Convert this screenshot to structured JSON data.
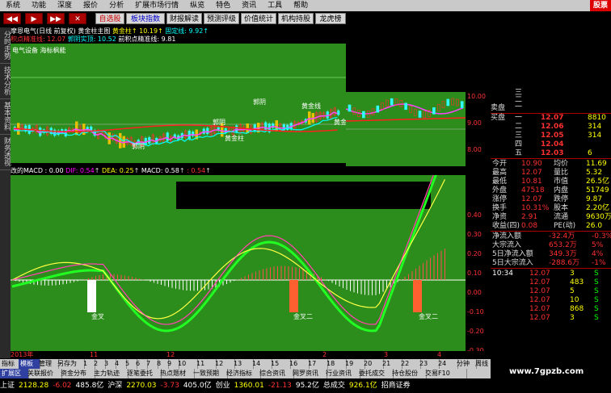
{
  "menu": {
    "items": [
      "系统",
      "功能",
      "深度",
      "报价",
      "分析",
      "扩展市场行情",
      "纵览",
      "特色",
      "资讯",
      "工具",
      "帮助"
    ],
    "brand": "股票"
  },
  "toolbar": {
    "nav_buttons": [
      "◀◀",
      "▶",
      "▶▶",
      "✕"
    ],
    "tabs": [
      {
        "label": "自选股",
        "color": "red"
      },
      {
        "label": "板块指数",
        "color": "blue"
      },
      {
        "label": "财报解读",
        "color": "normal"
      },
      {
        "label": "预测评级",
        "color": "normal"
      },
      {
        "label": "价值统计",
        "color": "normal"
      },
      {
        "label": "机构持股",
        "color": "normal"
      },
      {
        "label": "龙虎榜",
        "color": "normal"
      }
    ]
  },
  "left_vtabs": [
    "分时走势",
    "技术分析",
    "基本资料",
    "财务透视"
  ],
  "info": {
    "line1_a": "摩恩电气(日线 前复权) 黄金柱主图",
    "line1_b": "黄金柱↑",
    "line1_c": "10.19↑",
    "line1_d": "固定线: 9.92↑",
    "line2_a": "积点精准线: 12.07",
    "line2_b": "郭阴实顶: 10.52",
    "line2_c": "前积点精准线: 9.81",
    "chart_label": "电气设备 海标枫能"
  },
  "chart_labels": {
    "yin": "郭阴",
    "gold": "黄金柱",
    "gold_line": "黄金线",
    "cross": "金叉二",
    "cross1": "金叉"
  },
  "main_axis": [
    "10.00",
    "9.00",
    "8.00"
  ],
  "macd": {
    "name": "改的MACD",
    "v0": ": 0.00",
    "dif": "DIF: 0.54",
    "dea": "DEA: 0.25",
    "macd": "MACD: 0.58",
    "extra": ": 0.54",
    "axis": [
      "0.40",
      "0.30",
      "0.20",
      "0.10",
      "0.00",
      "-0.10",
      "-0.20",
      "-0.30"
    ]
  },
  "date_axis": [
    {
      "label": "2013年",
      "pos": 0
    },
    {
      "label": "11",
      "pos": 98
    },
    {
      "label": "12",
      "pos": 193
    },
    {
      "label": "2",
      "pos": 386
    },
    {
      "label": "3",
      "pos": 462
    },
    {
      "label": "4",
      "pos": 528
    }
  ],
  "bottom_tabs_row1": [
    "指标",
    "模板",
    "管理",
    "另存为",
    "1",
    "2",
    "3",
    "4",
    "5",
    "6",
    "7",
    "8",
    "9",
    "10",
    "11",
    "12",
    "13",
    "14",
    "15",
    "16",
    "17",
    "18",
    "19",
    "20",
    "21",
    "22",
    "23",
    "24",
    "分钟",
    "周线",
    "月线",
    "▷"
  ],
  "bottom_tabs_row1_selected": 1,
  "bottom_tabs_row2": [
    "扩展区",
    "关联报价",
    "资金分布",
    "主力轨迹",
    "逐笔委托",
    "热点题材",
    "一致预期",
    "经济指标",
    "综合资讯",
    "网罗资讯",
    "行业资讯",
    "委托成交",
    "持仓股份",
    "交易F10"
  ],
  "bottom_tabs_row2_selected": 0,
  "status": [
    {
      "label": "上证",
      "value": "2128.28",
      "change": "-6.02",
      "amount": "485.8亿"
    },
    {
      "label": "沪深",
      "value": "2270.03",
      "change": "-3.73",
      "amount": "405.0亿"
    },
    {
      "label": "创业",
      "value": "1360.01",
      "change": "-21.13",
      "amount": "95.2亿"
    },
    {
      "label": "总成交",
      "value": "926.1亿",
      "change": "",
      "amount": ""
    },
    {
      "label": "招商证券",
      "value": "",
      "change": "",
      "amount": ""
    }
  ],
  "right_panel": {
    "sell_label": "卖盘",
    "buy_label": "买盘",
    "sell_levels": [
      "三",
      "二",
      "一"
    ],
    "buy_levels": [
      {
        "level": "一",
        "price": "12.07",
        "vol": "8810"
      },
      {
        "level": "二",
        "price": "12.06",
        "vol": "314"
      },
      {
        "level": "三",
        "price": "12.05",
        "vol": "314"
      },
      {
        "level": "四",
        "price": "12.04",
        "vol": ""
      },
      {
        "level": "五",
        "price": "12.03",
        "vol": "6"
      }
    ],
    "stats": [
      {
        "l1": "今开",
        "v1": "10.90",
        "l2": "均价",
        "v2": "11.69"
      },
      {
        "l1": "最高",
        "v1": "12.07",
        "l2": "量比",
        "v2": "5.32"
      },
      {
        "l1": "最低",
        "v1": "10.81",
        "l2": "市值",
        "v2": "26.5亿"
      },
      {
        "l1": "外盘",
        "v1": "47518",
        "l2": "内盘",
        "v2": "51749"
      },
      {
        "l1": "涨停",
        "v1": "12.07",
        "l2": "跌停",
        "v2": "9.87"
      },
      {
        "l1": "换手",
        "v1": "10.31%",
        "l2": "股本",
        "v2": "2.20亿"
      },
      {
        "l1": "净资",
        "v1": "2.91",
        "l2": "流通",
        "v2": "9630万"
      },
      {
        "l1": "收益(四)",
        "v1": "0.08",
        "l2": "PE(动)",
        "v2": "26.0"
      }
    ],
    "flows": [
      {
        "label": "净流入额",
        "value": "-32.4万",
        "pct": "-0.3%"
      },
      {
        "label": "大宗流入",
        "value": "653.2万",
        "pct": "5%"
      },
      {
        "label": "5日净流入额",
        "value": "349.3万",
        "pct": "4%"
      },
      {
        "label": "5日大宗流入",
        "value": "-288.6万",
        "pct": "-1%"
      }
    ],
    "ticks": [
      {
        "time": "10:34",
        "price": "12.07",
        "vol": "3",
        "side": "S"
      },
      {
        "time": "",
        "price": "12.07",
        "vol": "483",
        "side": "S"
      },
      {
        "time": "",
        "price": "12.07",
        "vol": "5",
        "side": "S"
      },
      {
        "time": "",
        "price": "12.07",
        "vol": "10",
        "side": "S"
      },
      {
        "time": "",
        "price": "12.07",
        "vol": "868",
        "side": "S"
      },
      {
        "time": "",
        "price": "12.07",
        "vol": "3",
        "side": "S"
      }
    ]
  },
  "watermark": "www.7gpzb.com"
}
